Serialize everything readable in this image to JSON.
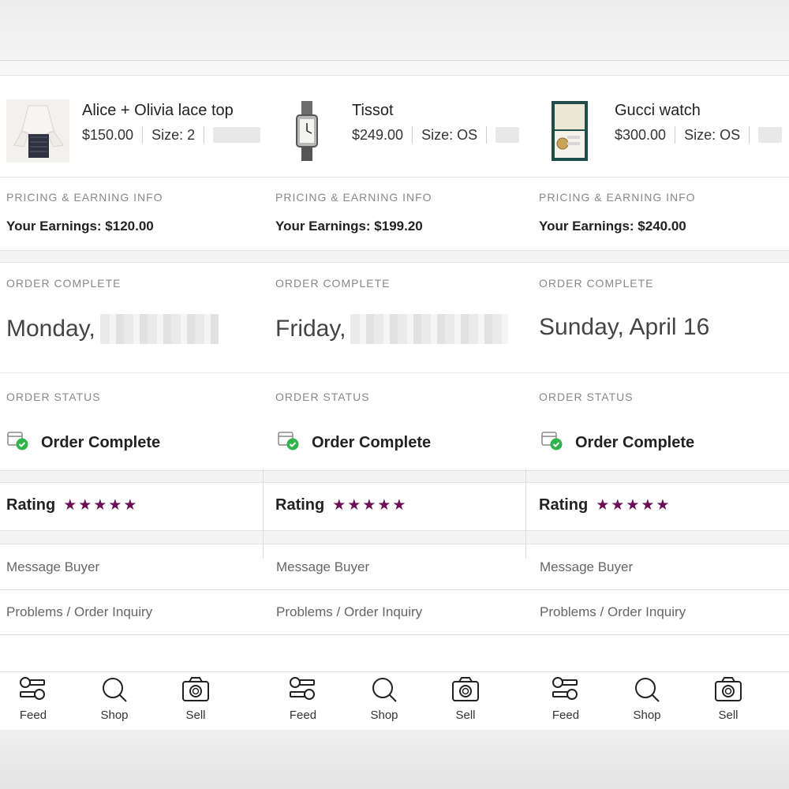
{
  "labels": {
    "pricing_header": "PRICING & EARNING INFO",
    "order_complete_header": "ORDER COMPLETE",
    "order_status_header": "ORDER STATUS",
    "rating": "Rating",
    "message_buyer": "Message Buyer",
    "problems": "Problems / Order Inquiry"
  },
  "nav": {
    "feed": "Feed",
    "shop": "Shop",
    "sell": "Sell"
  },
  "orders": [
    {
      "product_name": "Alice + Olivia lace top",
      "price": "$150.00",
      "size": "Size: 2",
      "earnings": "Your Earnings: $120.00",
      "date": "Monday, ",
      "status": "Order Complete",
      "rating_stars": 5
    },
    {
      "product_name": "Tissot",
      "price": "$249.00",
      "size": "Size: OS",
      "earnings": "Your Earnings: $199.20",
      "date": "Friday,",
      "status": "Order Complete",
      "rating_stars": 5
    },
    {
      "product_name": "Gucci watch",
      "price": "$300.00",
      "size": "Size: OS",
      "earnings": "Your Earnings: $240.00",
      "date": "Sunday, April 16",
      "status": "Order Complete",
      "rating_stars": 5
    }
  ],
  "colors": {
    "star": "#6b0f56",
    "check": "#2fb34a"
  },
  "icons": {
    "feed": "feed-icon",
    "shop": "search-icon",
    "sell": "camera-icon"
  }
}
